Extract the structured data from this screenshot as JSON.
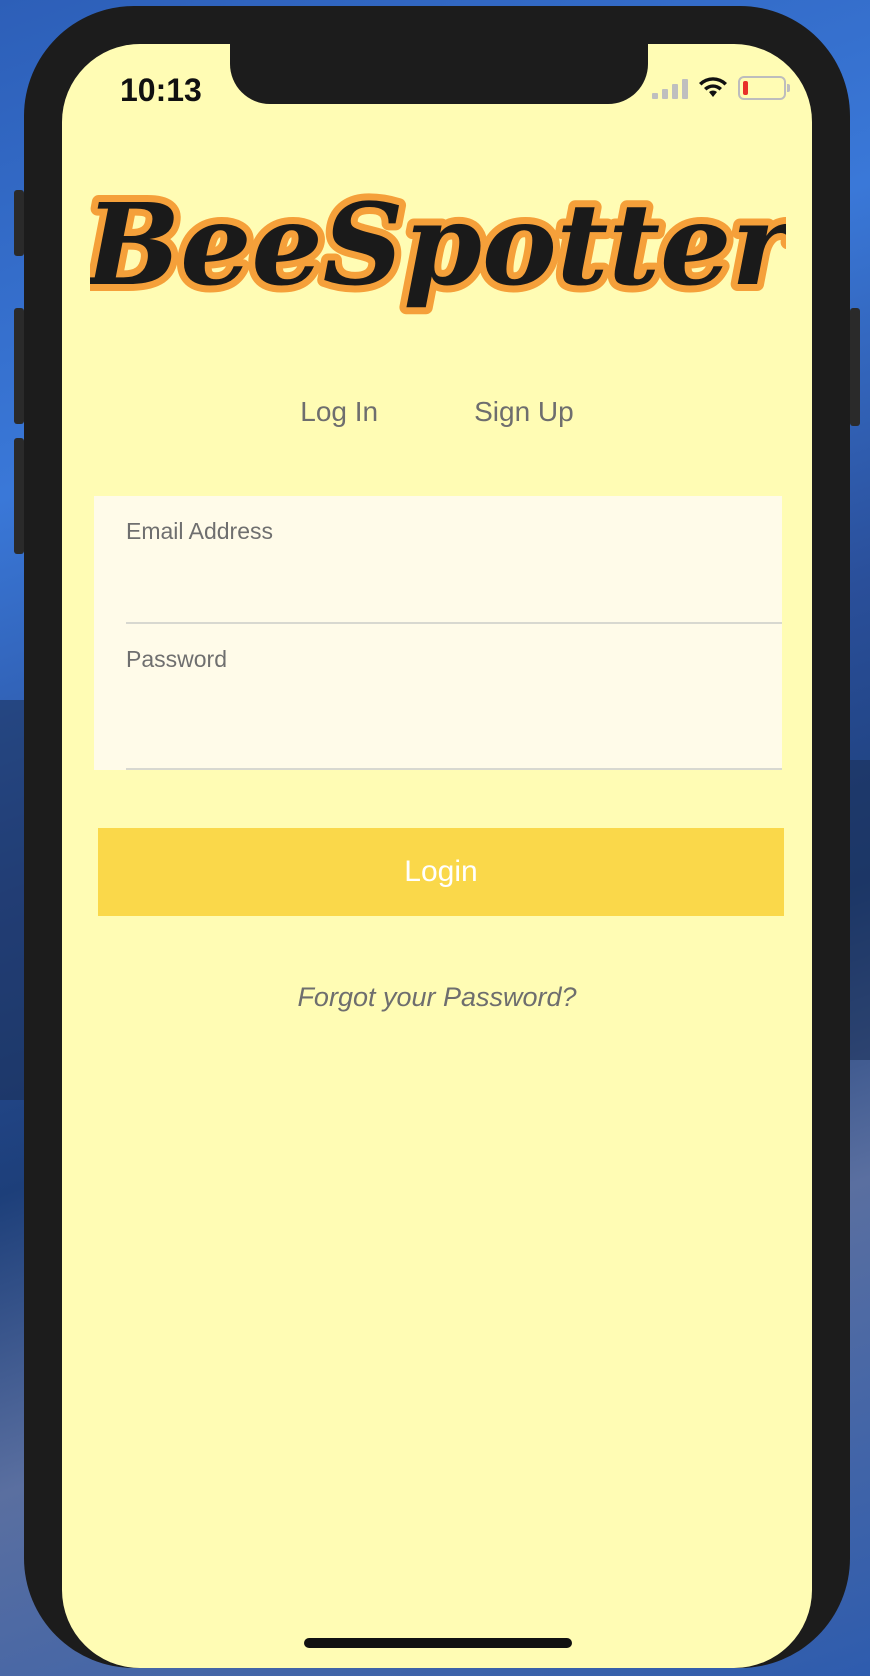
{
  "status_bar": {
    "time": "10:13"
  },
  "logo": {
    "text": "BeeSpotter",
    "fill_color": "#f5a03a",
    "stroke_color": "#111111"
  },
  "tabs": [
    {
      "label": "Log In"
    },
    {
      "label": "Sign Up"
    }
  ],
  "form": {
    "email": {
      "label": "Email Address",
      "value": ""
    },
    "password": {
      "label": "Password",
      "value": ""
    }
  },
  "login_button": {
    "label": "Login",
    "color": "#fad84a"
  },
  "forgot_link": {
    "label": "Forgot your Password?"
  },
  "colors": {
    "screen_background": "#fffcb4",
    "form_background": "#fffbe9",
    "text_gray": "#6e6e6e"
  }
}
